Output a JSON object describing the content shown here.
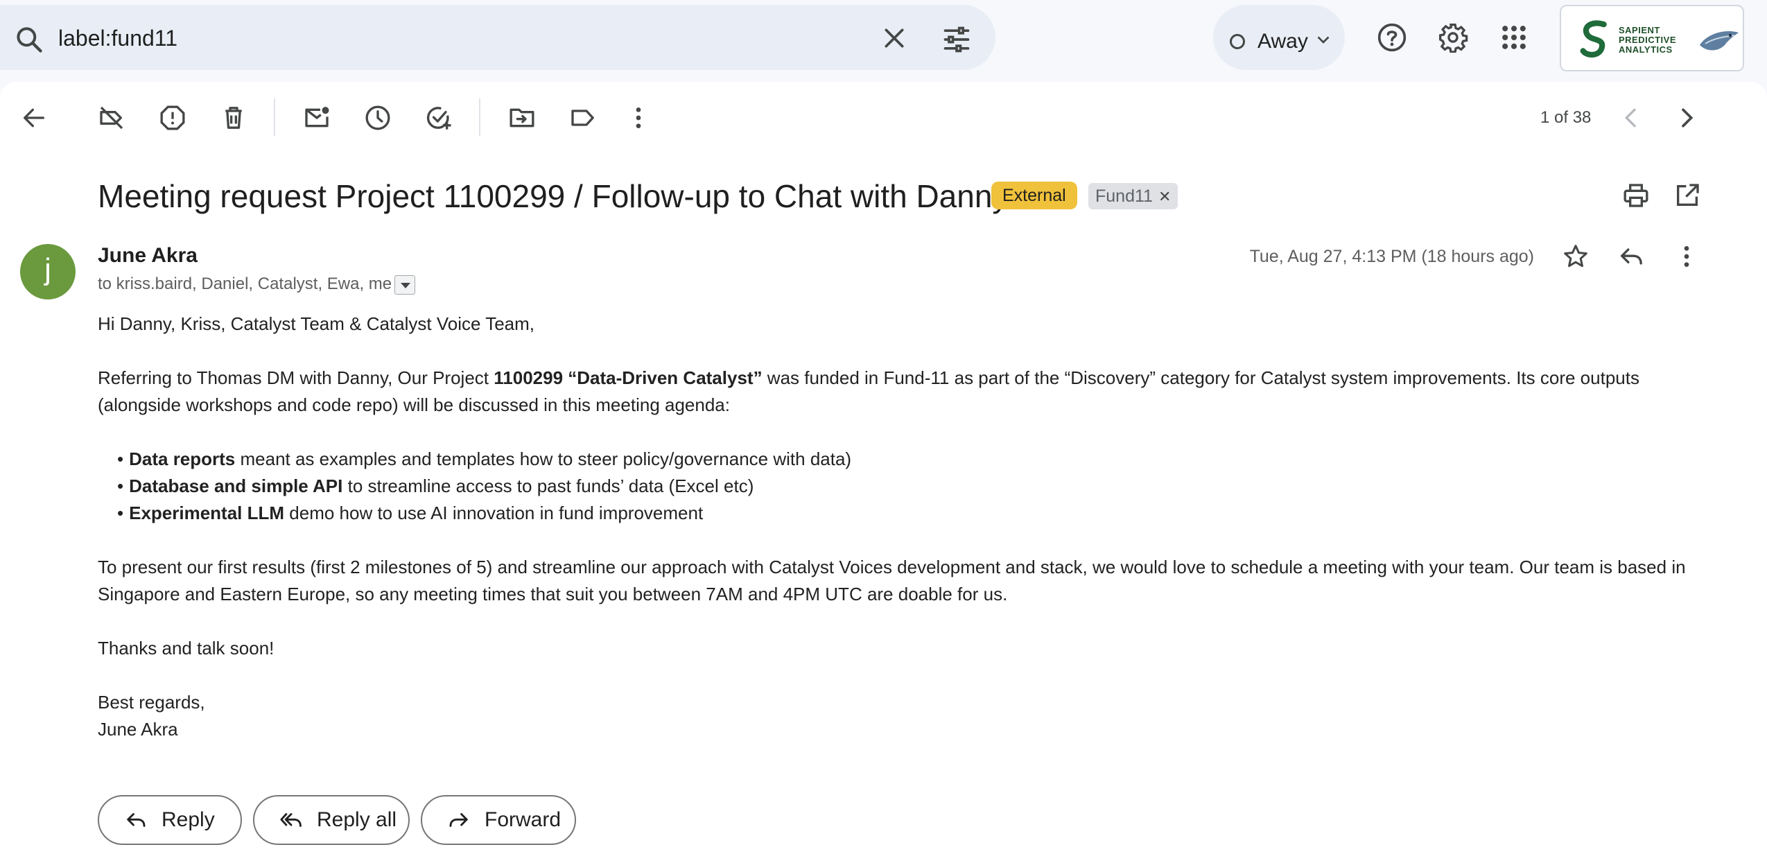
{
  "search": {
    "query": "label:fund11"
  },
  "status": {
    "label": "Away"
  },
  "brand": {
    "lines": [
      "SAPIENT",
      "PREDICTIVE",
      "ANALYTICS"
    ]
  },
  "toolbar": {
    "pager": "1 of 38"
  },
  "email": {
    "subject": "Meeting request Project 1100299 / Follow-up to Chat with Danny",
    "labels": {
      "external": "External",
      "fund": "Fund11"
    },
    "avatar_letter": "j",
    "sender": "June Akra",
    "recipients": "to kriss.baird, Daniel, Catalyst, Ewa, me",
    "date": "Tue, Aug 27, 4:13 PM (18 hours ago)",
    "greeting": "Hi Danny, Kriss, Catalyst Team & Catalyst Voice Team,",
    "intro_pre": "Referring to Thomas DM with Danny, Our Project ",
    "intro_bold": "1100299 “Data-Driven Catalyst”",
    "intro_post": " was funded in Fund-11 as part of the “Discovery” category for Catalyst system improvements. Its core outputs (alongside workshops and code repo) will be discussed in this meeting agenda:",
    "bullets": [
      {
        "bold": "Data reports",
        "rest": " meant as examples and templates how to steer policy/governance with data)"
      },
      {
        "bold": "Database and simple API",
        "rest": " to streamline access to past funds’ data (Excel etc)"
      },
      {
        "bold": "Experimental LLM",
        "rest": " demo how to use AI innovation in fund improvement"
      }
    ],
    "para2": "To present our first results (first 2 milestones of 5) and streamline our approach with Catalyst Voices development and stack, we would love to schedule a meeting with your team. Our team is based in Singapore and Eastern Europe, so any meeting times that suit you between 7AM and 4PM UTC are doable for us.",
    "closing": "Thanks and talk soon!",
    "sign_1": "Best regards,",
    "sign_2": "June Akra"
  },
  "actions": {
    "reply": "Reply",
    "reply_all": "Reply all",
    "forward": "Forward"
  },
  "colors": {
    "external_chip": "#f0c13a",
    "avatar": "#6a9a3d",
    "search_bg": "#e9eef6"
  }
}
